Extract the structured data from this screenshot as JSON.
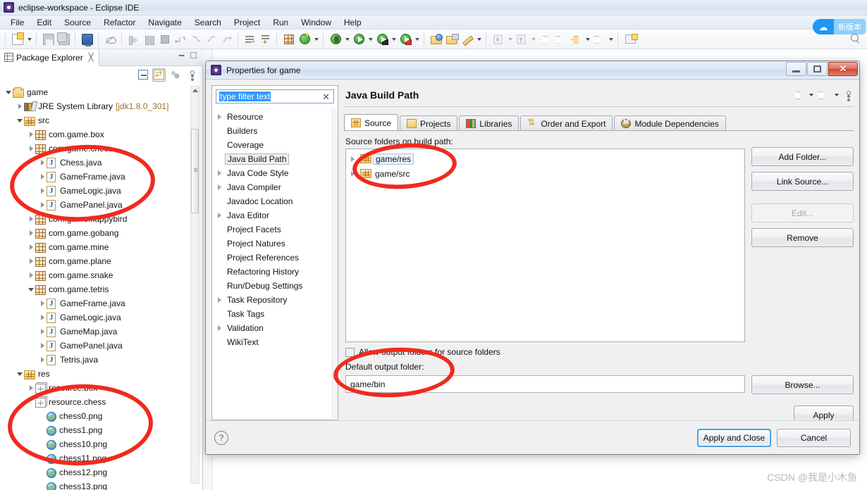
{
  "window": {
    "title": "eclipse-workspace - Eclipse IDE",
    "icon": "eclipse-icon"
  },
  "menubar": {
    "items": [
      {
        "label": "File"
      },
      {
        "label": "Edit"
      },
      {
        "label": "Source"
      },
      {
        "label": "Refactor"
      },
      {
        "label": "Navigate"
      },
      {
        "label": "Search"
      },
      {
        "label": "Project"
      },
      {
        "label": "Run"
      },
      {
        "label": "Window"
      },
      {
        "label": "Help"
      }
    ]
  },
  "toolbar": {
    "icons": [
      "new-document-icon",
      "dropdown-arrow-icon",
      "save-icon",
      "save-all-icon",
      "console-icon",
      "skip-breakpoints-icon",
      "step-into-icon",
      "pause-icon",
      "terminate-icon",
      "step-over-icon",
      "step-return-icon",
      "resume-icon",
      "disconnect-icon",
      "next-annotation-icon",
      "toggle-mark-occurrences-icon",
      "open-type-icon",
      "search-icon",
      "debug-icon",
      "run-icon",
      "run-external-tools-icon",
      "coverage-icon",
      "new-java-project-icon",
      "new-folder-icon",
      "new-package-icon",
      "new-class-icon",
      "import-icon",
      "export-icon",
      "back-icon",
      "forward-icon",
      "previous-edit-icon",
      "next-edit-icon",
      "new-window-icon"
    ]
  },
  "cloud_badge": {
    "icon": "cloud-icon",
    "label": "新版本"
  },
  "package_explorer": {
    "tab_label": "Package Explorer",
    "tab_icon": "package-explorer-icon",
    "close_icon": "close-icon",
    "toolbar_icons": [
      "collapse-all-icon",
      "link-with-editor-icon",
      "focus-on-active-task-icon",
      "view-menu-icon"
    ],
    "window_controls": [
      "minimize-icon",
      "maximize-icon"
    ],
    "tree": [
      {
        "label": "game",
        "icon": "project-icon",
        "indent": 0,
        "twisty": "open",
        "suffix": ""
      },
      {
        "label": "JRE System Library",
        "icon": "jre-icon",
        "indent": 1,
        "twisty": "closed",
        "suffix": "[jdk1.8.0_301]"
      },
      {
        "label": "src",
        "icon": "source-folder-icon",
        "indent": 1,
        "twisty": "open",
        "suffix": ""
      },
      {
        "label": "com.game.box",
        "icon": "package-icon",
        "indent": 2,
        "twisty": "closed",
        "suffix": ""
      },
      {
        "label": "com.game.chess",
        "icon": "package-icon",
        "indent": 2,
        "twisty": "closed",
        "suffix": ""
      },
      {
        "label": "Chess.java",
        "icon": "java-file-icon",
        "indent": 3,
        "twisty": "closed",
        "suffix": ""
      },
      {
        "label": "GameFrame.java",
        "icon": "java-file-icon",
        "indent": 3,
        "twisty": "closed",
        "suffix": ""
      },
      {
        "label": "GameLogic.java",
        "icon": "java-file-icon",
        "indent": 3,
        "twisty": "closed",
        "suffix": ""
      },
      {
        "label": "GamePanel.java",
        "icon": "java-file-icon",
        "indent": 3,
        "twisty": "closed",
        "suffix": ""
      },
      {
        "label": "com.game.flappybird",
        "icon": "package-icon",
        "indent": 2,
        "twisty": "closed",
        "suffix": ""
      },
      {
        "label": "com.game.gobang",
        "icon": "package-icon",
        "indent": 2,
        "twisty": "closed",
        "suffix": ""
      },
      {
        "label": "com.game.mine",
        "icon": "package-icon",
        "indent": 2,
        "twisty": "closed",
        "suffix": ""
      },
      {
        "label": "com.game.plane",
        "icon": "package-icon",
        "indent": 2,
        "twisty": "closed",
        "suffix": ""
      },
      {
        "label": "com.game.snake",
        "icon": "package-icon",
        "indent": 2,
        "twisty": "closed",
        "suffix": ""
      },
      {
        "label": "com.game.tetris",
        "icon": "package-icon",
        "indent": 2,
        "twisty": "open",
        "suffix": ""
      },
      {
        "label": "GameFrame.java",
        "icon": "java-file-icon",
        "indent": 3,
        "twisty": "closed",
        "suffix": ""
      },
      {
        "label": "GameLogic.java",
        "icon": "java-file-icon",
        "indent": 3,
        "twisty": "closed",
        "suffix": ""
      },
      {
        "label": "GameMap.java",
        "icon": "java-file-icon",
        "indent": 3,
        "twisty": "closed",
        "suffix": ""
      },
      {
        "label": "GamePanel.java",
        "icon": "java-file-icon",
        "indent": 3,
        "twisty": "closed",
        "suffix": ""
      },
      {
        "label": "Tetris.java",
        "icon": "java-file-icon",
        "indent": 3,
        "twisty": "closed",
        "suffix": ""
      },
      {
        "label": "res",
        "icon": "source-folder-icon",
        "indent": 1,
        "twisty": "open",
        "suffix": ""
      },
      {
        "label": "resource.box",
        "icon": "resource-package-icon",
        "indent": 2,
        "twisty": "closed",
        "suffix": ""
      },
      {
        "label": "resource.chess",
        "icon": "resource-package-icon",
        "indent": 2,
        "twisty": "none",
        "suffix": ""
      },
      {
        "label": "chess0.png",
        "icon": "png-file-icon",
        "indent": 3,
        "twisty": "none",
        "suffix": ""
      },
      {
        "label": "chess1.png",
        "icon": "png-file-icon",
        "indent": 3,
        "twisty": "none",
        "suffix": ""
      },
      {
        "label": "chess10.png",
        "icon": "png-file-icon",
        "indent": 3,
        "twisty": "none",
        "suffix": ""
      },
      {
        "label": "chess11.png",
        "icon": "png-file-icon",
        "indent": 3,
        "twisty": "none",
        "suffix": ""
      },
      {
        "label": "chess12.png",
        "icon": "png-file-icon",
        "indent": 3,
        "twisty": "none",
        "suffix": ""
      },
      {
        "label": "chess13.png",
        "icon": "png-file-icon",
        "indent": 3,
        "twisty": "none",
        "suffix": ""
      }
    ]
  },
  "dialog": {
    "title": "Properties for game",
    "title_icon": "eclipse-icon",
    "window_controls": {
      "minimize": "minimize-icon",
      "restore": "restore-icon",
      "close": "✕"
    },
    "filter": {
      "value": "type filter text",
      "clear_icon": "✕"
    },
    "pages": [
      {
        "label": "Resource",
        "twisty": "closed",
        "selected": false
      },
      {
        "label": "Builders",
        "twisty": "none",
        "selected": false
      },
      {
        "label": "Coverage",
        "twisty": "none",
        "selected": false
      },
      {
        "label": "Java Build Path",
        "twisty": "none",
        "selected": true
      },
      {
        "label": "Java Code Style",
        "twisty": "closed",
        "selected": false
      },
      {
        "label": "Java Compiler",
        "twisty": "closed",
        "selected": false
      },
      {
        "label": "Javadoc Location",
        "twisty": "none",
        "selected": false
      },
      {
        "label": "Java Editor",
        "twisty": "closed",
        "selected": false
      },
      {
        "label": "Project Facets",
        "twisty": "none",
        "selected": false
      },
      {
        "label": "Project Natures",
        "twisty": "none",
        "selected": false
      },
      {
        "label": "Project References",
        "twisty": "none",
        "selected": false
      },
      {
        "label": "Refactoring History",
        "twisty": "none",
        "selected": false
      },
      {
        "label": "Run/Debug Settings",
        "twisty": "none",
        "selected": false
      },
      {
        "label": "Task Repository",
        "twisty": "closed",
        "selected": false
      },
      {
        "label": "Task Tags",
        "twisty": "none",
        "selected": false
      },
      {
        "label": "Validation",
        "twisty": "closed",
        "selected": false
      },
      {
        "label": "WikiText",
        "twisty": "none",
        "selected": false
      }
    ],
    "page_title": "Java Build Path",
    "header_icons": [
      "back-icon",
      "back-dropdown-icon",
      "forward-icon",
      "forward-dropdown-icon",
      "view-menu-icon"
    ],
    "tabs": [
      {
        "label": "Source",
        "icon": "source-folder-icon",
        "active": true
      },
      {
        "label": "Projects",
        "icon": "projects-icon",
        "active": false
      },
      {
        "label": "Libraries",
        "icon": "libraries-icon",
        "active": false
      },
      {
        "label": "Order and Export",
        "icon": "order-export-icon",
        "active": false
      },
      {
        "label": "Module Dependencies",
        "icon": "module-icon",
        "active": false
      }
    ],
    "source_section": {
      "label": "Source folders on build path:",
      "entries": [
        {
          "label": "game/res",
          "icon": "source-folder-icon",
          "focused": true
        },
        {
          "label": "game/src",
          "icon": "source-folder-icon",
          "focused": false
        }
      ]
    },
    "side_buttons": [
      {
        "label": "Add Folder...",
        "disabled": false
      },
      {
        "label": "Link Source...",
        "disabled": false
      },
      {
        "label": "Edit...",
        "disabled": true
      },
      {
        "label": "Remove",
        "disabled": false
      }
    ],
    "allow_output_checkbox": {
      "label": "Allow output folders for source folders",
      "checked": false
    },
    "default_output": {
      "label": "Default output folder:",
      "value": "game/bin",
      "browse_label": "Browse..."
    },
    "apply_label": "Apply",
    "footer": {
      "help_icon": "?",
      "apply_and_close_label": "Apply and Close",
      "cancel_label": "Cancel"
    }
  },
  "annotations": {
    "color": "#f02a1d",
    "shapes": [
      "ellipse-chess-package",
      "ellipse-resource-chess",
      "ellipse-source-folders",
      "ellipse-default-output"
    ]
  },
  "watermark": {
    "text": "CSDN @我是小木鱼"
  }
}
